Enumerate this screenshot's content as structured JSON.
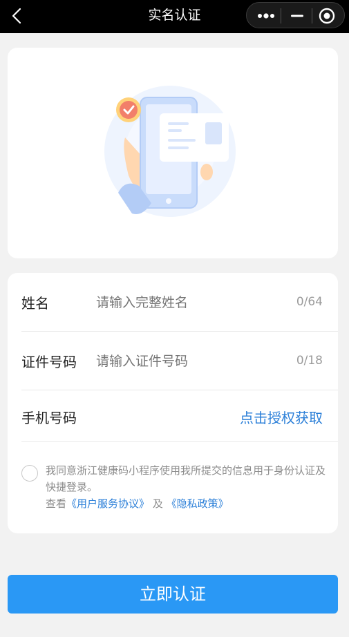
{
  "nav": {
    "title": "实名认证"
  },
  "capsule": {
    "icons": [
      "more-icon",
      "minimize-icon",
      "close-target-icon"
    ]
  },
  "form": {
    "name": {
      "label": "姓名",
      "placeholder": "请输入完整姓名",
      "counter": "0/64"
    },
    "id_number": {
      "label": "证件号码",
      "placeholder": "请输入证件号码",
      "counter": "0/18"
    },
    "phone": {
      "label": "手机号码",
      "action": "点击授权获取"
    }
  },
  "agreement": {
    "text_line": "我同意浙江健康码小程序使用我所提交的信息用于身份认证及快捷登录。",
    "view_prefix": "查看",
    "user_agreement": "《用户服务协议》",
    "and": "及",
    "privacy_policy": "《隐私政策》"
  },
  "submit": {
    "label": "立即认证"
  },
  "colors": {
    "accent": "#2a98f5",
    "link": "#2b7fd8",
    "background": "#f2f2f2"
  }
}
